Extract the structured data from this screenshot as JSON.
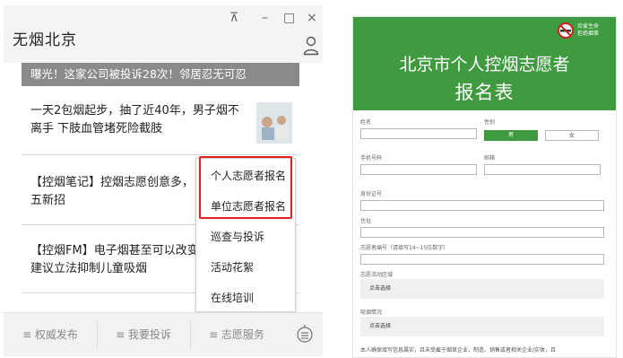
{
  "window": {
    "title": "无烟北京",
    "pin": "⊼",
    "minimize": "–",
    "maximize": "□",
    "close": "×"
  },
  "feed": {
    "banner": "曝光！这家公司被投诉28次！邻居忍无可忍",
    "articles": [
      {
        "title": "一天2包烟起步，抽了近40年，男子烟不离手 下肢血管堵死险截肢"
      },
      {
        "title": "【控烟笔记】控烟志愿创意多，五新招"
      },
      {
        "title": "【控烟FM】电子烟甚至可以改变建议立法抑制儿童吸烟"
      }
    ]
  },
  "popup_menu": {
    "items": [
      "个人志愿者报名",
      "单位志愿者报名",
      "巡查与投诉",
      "活动花絮",
      "在线培训"
    ]
  },
  "tabbar": {
    "tabs": [
      "≡ 权威发布",
      "≡ 我要投诉",
      "≡ 志愿服务"
    ]
  },
  "form": {
    "brand": "珍爱生命\n拒绝烟草",
    "title_line1": "北京市个人控烟志愿者",
    "title_line2": "报名表",
    "labels": {
      "name": "姓名",
      "gender": "性别",
      "phone": "手机号码",
      "email": "邮箱",
      "id_number": "身份证号",
      "address": "住址",
      "volunteer_no": "志愿者编号（请填写14~15位数字）",
      "activity_area": "志愿活动区域",
      "smoking": "吸烟情况"
    },
    "gender_options": [
      "男",
      "女"
    ],
    "select_placeholder": "点击选择",
    "footnote": "本人确保填写信息属实，且未受雇于烟草企业，制造、销售或者相关企业/实体，且"
  },
  "colors": {
    "form_green": "#3f9a40",
    "highlight_red": "#e02020",
    "banner_gray": "#8a8a8a"
  }
}
